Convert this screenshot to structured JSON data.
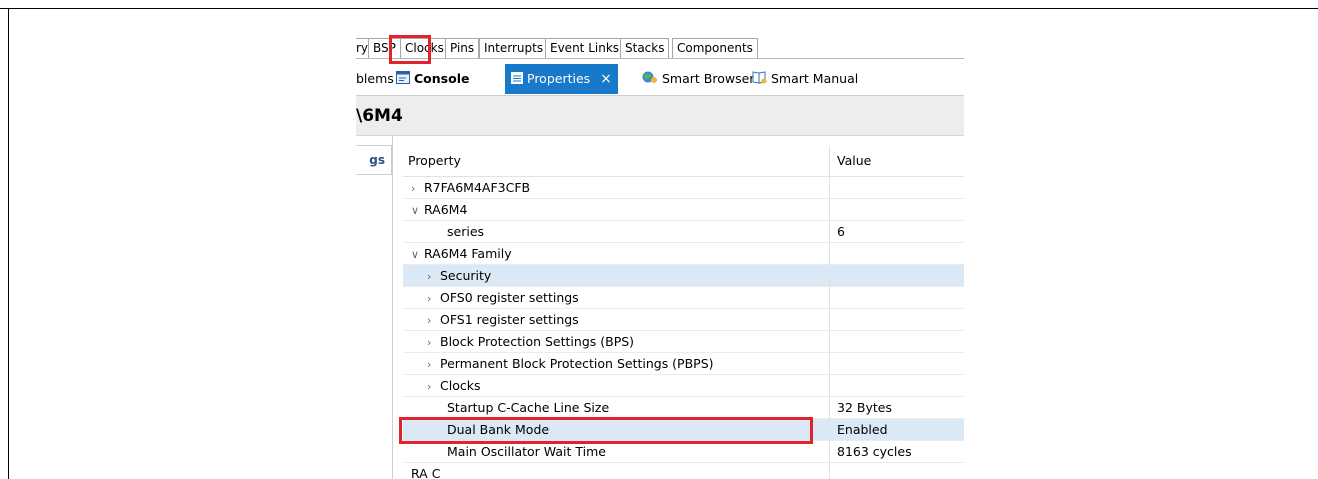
{
  "editor_tabs": [
    {
      "label": "ry",
      "partial": true
    },
    {
      "label": "BSP",
      "highlighted": true
    },
    {
      "label": "Clocks"
    },
    {
      "label": "Pins"
    },
    {
      "label": "Interrupts"
    },
    {
      "label": "Event Links"
    },
    {
      "label": "Stacks"
    },
    {
      "label": "Components"
    }
  ],
  "view_tabs": {
    "problems": "blems",
    "console": "Console",
    "properties": "Properties",
    "properties_close": "×",
    "smart_browser": "Smart Browser",
    "smart_manual": "Smart Manual"
  },
  "properties_title": "\\6M4",
  "side_tab": "gs",
  "table": {
    "columns": [
      "Property",
      "Value"
    ],
    "rows": [
      {
        "name": "R7FA6M4AF3CFB",
        "value": "",
        "indent": 0,
        "twisty": "collapsed"
      },
      {
        "name": "RA6M4",
        "value": "",
        "indent": 0,
        "twisty": "expanded"
      },
      {
        "name": "series",
        "value": "6",
        "indent": 2,
        "twisty": "none"
      },
      {
        "name": "RA6M4 Family",
        "value": "",
        "indent": 0,
        "twisty": "expanded"
      },
      {
        "name": "Security",
        "value": "",
        "indent": 1,
        "twisty": "collapsed",
        "selected": true
      },
      {
        "name": "OFS0 register settings",
        "value": "",
        "indent": 1,
        "twisty": "collapsed"
      },
      {
        "name": "OFS1 register settings",
        "value": "",
        "indent": 1,
        "twisty": "collapsed"
      },
      {
        "name": "Block Protection Settings (BPS)",
        "value": "",
        "indent": 1,
        "twisty": "collapsed"
      },
      {
        "name": "Permanent Block Protection Settings (PBPS)",
        "value": "",
        "indent": 1,
        "twisty": "collapsed"
      },
      {
        "name": "Clocks",
        "value": "",
        "indent": 1,
        "twisty": "collapsed"
      },
      {
        "name": "Startup C-Cache Line Size",
        "value": "32 Bytes",
        "indent": 2,
        "twisty": "none"
      },
      {
        "name": "Dual Bank Mode",
        "value": "Enabled",
        "indent": 2,
        "twisty": "none",
        "selected": true,
        "highlighted": true
      },
      {
        "name": "Main Oscillator Wait Time",
        "value": "8163 cycles",
        "indent": 2,
        "twisty": "none"
      },
      {
        "name": "RA C",
        "value": "",
        "indent": 0,
        "twisty": "none",
        "partial": true
      }
    ]
  },
  "colors": {
    "highlight_box": "#e3232b",
    "active_tab": "#1878c9",
    "selected_row": "#dbe9f7"
  }
}
